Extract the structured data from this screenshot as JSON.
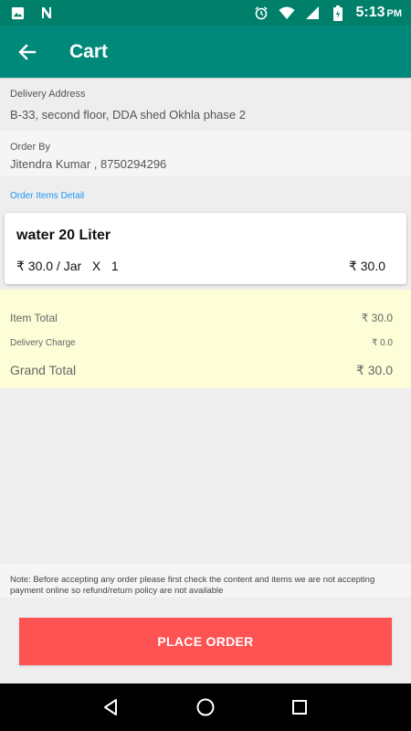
{
  "status_bar": {
    "time": "5:13",
    "ampm": "PM",
    "left_icons": [
      "image-icon",
      "n-notification-icon"
    ],
    "right_icons": [
      "alarm-icon",
      "wifi-icon",
      "signal-icon",
      "battery-icon"
    ]
  },
  "app_bar": {
    "title": "Cart",
    "back_icon": "arrow-back-icon",
    "color": "#00897b"
  },
  "delivery": {
    "label": "Delivery Address",
    "address": "B-33, second floor, DDA shed Okhla phase 2"
  },
  "order_by": {
    "label": "Order By",
    "value": "Jitendra Kumar , 8750294296"
  },
  "items_detail_label": "Order Items Detail",
  "items": [
    {
      "name": "water 20 Liter",
      "rate": "₹ 30.0 / Jar   X   1",
      "total": "₹ 30.0"
    }
  ],
  "summary": {
    "item_total_label": "Item Total",
    "item_total_value": "₹ 30.0",
    "delivery_label": "Delivery Charge",
    "delivery_value": "₹ 0.0",
    "grand_label": "Grand Total",
    "grand_value": "₹ 30.0"
  },
  "note": "Note: Before accepting any order please first check the content and items we are not accepting payment online so refund/return policy are not available",
  "place_order_label": "PLACE ORDER",
  "colors": {
    "accent": "#00897b",
    "button": "#ff5252",
    "summary_bg": "#fdfdd8",
    "link": "#2196f3"
  },
  "nav_icons": [
    "back-nav-icon",
    "home-nav-icon",
    "recents-nav-icon"
  ]
}
